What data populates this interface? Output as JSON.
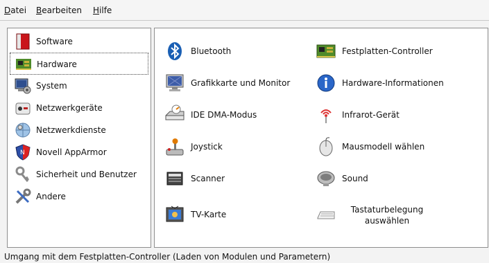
{
  "menubar": {
    "items": [
      {
        "acc": "D",
        "rest": "atei"
      },
      {
        "acc": "B",
        "rest": "earbeiten"
      },
      {
        "acc": "H",
        "rest": "ilfe"
      }
    ]
  },
  "sidebar": {
    "items": [
      {
        "label": "Software",
        "icon": "software-icon"
      },
      {
        "label": "Hardware",
        "icon": "hardware-icon",
        "selected": true
      },
      {
        "label": "System",
        "icon": "system-icon"
      },
      {
        "label": "Netzwerkgeräte",
        "icon": "network-devices-icon"
      },
      {
        "label": "Netzwerkdienste",
        "icon": "network-services-icon"
      },
      {
        "label": "Novell AppArmor",
        "icon": "apparmor-shield-icon"
      },
      {
        "label": "Sicherheit und Benutzer",
        "icon": "security-keys-icon"
      },
      {
        "label": "Andere",
        "icon": "tools-icon"
      }
    ]
  },
  "modules": {
    "left": [
      {
        "label": "Bluetooth",
        "icon": "bluetooth-icon"
      },
      {
        "label": "Grafikkarte und Monitor",
        "icon": "monitor-icon"
      },
      {
        "label": "IDE DMA-Modus",
        "icon": "drive-icon"
      },
      {
        "label": "Joystick",
        "icon": "joystick-icon"
      },
      {
        "label": "Scanner",
        "icon": "scanner-icon"
      },
      {
        "label": "TV-Karte",
        "icon": "tv-card-icon"
      }
    ],
    "right": [
      {
        "label": "Festplatten-Controller",
        "icon": "controller-board-icon"
      },
      {
        "label": "Hardware-Informationen",
        "icon": "info-icon"
      },
      {
        "label": "Infrarot-Gerät",
        "icon": "infrared-icon"
      },
      {
        "label": "Mausmodell wählen",
        "icon": "mouse-icon"
      },
      {
        "label": "Sound",
        "icon": "sound-icon"
      },
      {
        "label": "Tastaturbelegung auswählen",
        "line1": "Tastaturbelegung",
        "line2": "auswählen",
        "icon": "keyboard-icon"
      }
    ]
  },
  "status": {
    "text": "Umgang mit dem Festplatten-Controller (Laden von Modulen und Parametern)"
  }
}
